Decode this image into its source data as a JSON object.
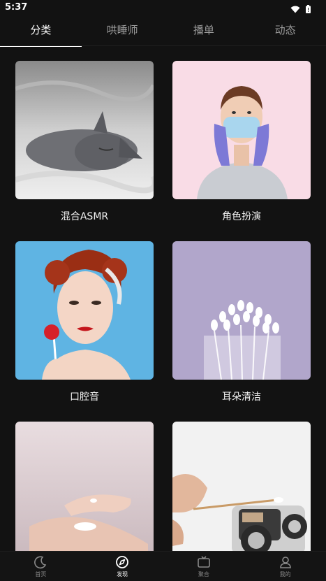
{
  "status_bar": {
    "time": "5:37"
  },
  "tabs": [
    {
      "label": "分类",
      "active": true
    },
    {
      "label": "哄睡师",
      "active": false
    },
    {
      "label": "播单",
      "active": false
    },
    {
      "label": "动态",
      "active": false
    }
  ],
  "categories": [
    {
      "label": "混合ASMR",
      "image": "sleeping-gray-cat"
    },
    {
      "label": "角色扮演",
      "image": "nurse-in-mask-and-gloves"
    },
    {
      "label": "口腔音",
      "image": "woman-with-lollipop"
    },
    {
      "label": "耳朵清洁",
      "image": "cotton-swabs-in-glass"
    },
    {
      "label": "",
      "image": "hands-with-lotion"
    },
    {
      "label": "",
      "image": "cotton-swab-and-microphone"
    }
  ],
  "bottom_nav": [
    {
      "label": "首页",
      "icon": "moon-icon",
      "active": false
    },
    {
      "label": "发现",
      "icon": "compass-icon",
      "active": true
    },
    {
      "label": "聚合",
      "icon": "tv-icon",
      "active": false
    },
    {
      "label": "我的",
      "icon": "person-icon",
      "active": false
    }
  ],
  "colors": {
    "background": "#121212",
    "active_text": "#ffffff",
    "inactive_text": "#9a9a9a"
  }
}
